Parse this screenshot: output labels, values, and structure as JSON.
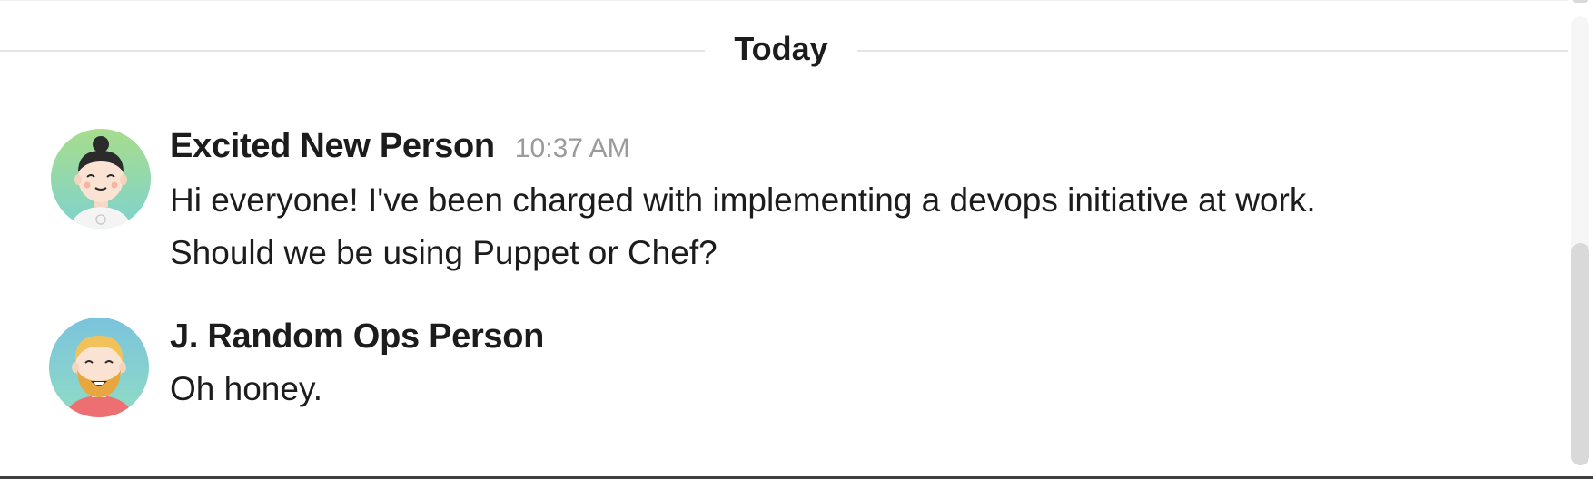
{
  "divider": {
    "label": "Today"
  },
  "messages": [
    {
      "sender": "Excited New Person",
      "time": "10:37 AM",
      "lines": [
        "Hi everyone! I've been charged with implementing a devops initiative at work.",
        "Should we be using Puppet or Chef?"
      ],
      "avatar": "avatar-smiling-topknot-person"
    },
    {
      "sender": "J. Random Ops Person",
      "lines": [
        "Oh honey."
      ],
      "avatar": "avatar-bearded-blond-person"
    }
  ],
  "colors": {
    "text": "#1d1c1d",
    "timestamp": "#9b9b9b",
    "divider_line": "#e6e6e6",
    "scroll_thumb": "#d9d9d9"
  }
}
